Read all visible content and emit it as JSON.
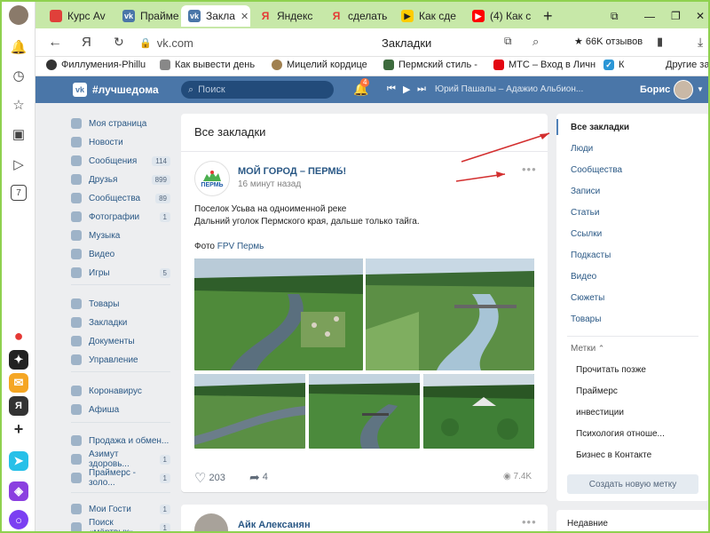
{
  "browser": {
    "tabs": [
      {
        "label": "Курс Av",
        "fav_color": "#e0403a",
        "fav_glyph": ""
      },
      {
        "label": "Прайме",
        "fav_color": "#4a76a8",
        "fav_glyph": "vk"
      },
      {
        "label": "Закла",
        "fav_color": "#4a76a8",
        "fav_glyph": "vk"
      },
      {
        "label": "Яндекс",
        "fav_color": "#ffffff",
        "fav_glyph": "Я"
      },
      {
        "label": "сделать",
        "fav_color": "#ffffff",
        "fav_glyph": "Я"
      },
      {
        "label": "Как сде",
        "fav_color": "#ffcc00",
        "fav_glyph": "▶"
      },
      {
        "label": "(4) Как с",
        "fav_color": "#ff0000",
        "fav_glyph": "▶"
      }
    ],
    "new_tab": "+",
    "address": {
      "back": "←",
      "yandex": "Я",
      "reload": "↻",
      "url": "vk.com",
      "page_title": "Закладки",
      "reviews": "★ 66K отзывов"
    },
    "bookmarks": [
      "Филлумения-Phillu",
      "Как вывести день",
      "Мицелий кордице",
      "Пермский стиль -",
      "МТС – Вход в Личн",
      "К",
      "Другие зак"
    ],
    "sidebar_counter": "7"
  },
  "vk": {
    "header": {
      "tag": "#лучшедома",
      "search_placeholder": "Поиск",
      "bell_count": "4",
      "track": "Юрий Пашалы – Адажио Альбион...",
      "user": "Борис"
    },
    "menu": [
      {
        "label": "Моя страница",
        "count": ""
      },
      {
        "label": "Новости",
        "count": ""
      },
      {
        "label": "Сообщения",
        "count": "114"
      },
      {
        "label": "Друзья",
        "count": "899"
      },
      {
        "label": "Сообщества",
        "count": "89"
      },
      {
        "label": "Фотографии",
        "count": "1"
      },
      {
        "label": "Музыка",
        "count": ""
      },
      {
        "label": "Видео",
        "count": ""
      },
      {
        "label": "Игры",
        "count": "5"
      },
      {
        "label": "Товары",
        "count": ""
      },
      {
        "label": "Закладки",
        "count": ""
      },
      {
        "label": "Документы",
        "count": ""
      },
      {
        "label": "Управление",
        "count": ""
      },
      {
        "label": "Коронавирус",
        "count": ""
      },
      {
        "label": "Афиша",
        "count": ""
      },
      {
        "label": "Продажа и обмен...",
        "count": ""
      },
      {
        "label": "Азимут здоровь...",
        "count": "1"
      },
      {
        "label": "Праймерс - золо...",
        "count": "1"
      },
      {
        "label": "Мои Гости",
        "count": "1"
      },
      {
        "label": "Поиск «мёртвых»",
        "count": "1"
      }
    ],
    "feed_title": "Все закладки",
    "post": {
      "author": "МОЙ ГОРОД – ПЕРМЬ!",
      "time": "16 минут назад",
      "line1": "Поселок Усьва на одноименной реке",
      "line2": "Дальний уголок Пермского края, дальше только тайга.",
      "photo_prefix": "Фото ",
      "photo_link": "FPV Пермь",
      "likes": "203",
      "shares": "4",
      "views": "7.4K",
      "logo_text": "ПЕРМЬ"
    },
    "post2_author": "Айк Алексанян",
    "right_menu": [
      "Все закладки",
      "Люди",
      "Сообщества",
      "Записи",
      "Статьи",
      "Ссылки",
      "Подкасты",
      "Видео",
      "Сюжеты",
      "Товары"
    ],
    "tags_title": "Метки",
    "tags": [
      "Прочитать позже",
      "Праймерс",
      "инвестиции",
      "Психология отноше...",
      "Бизнес в Контакте"
    ],
    "new_tag": "Создать новую метку",
    "recent": "Недавние"
  },
  "colors": {
    "vk_blue": "#4a76a8",
    "tab_green": "#c7e8a8",
    "annotation": "#d32f2f"
  }
}
